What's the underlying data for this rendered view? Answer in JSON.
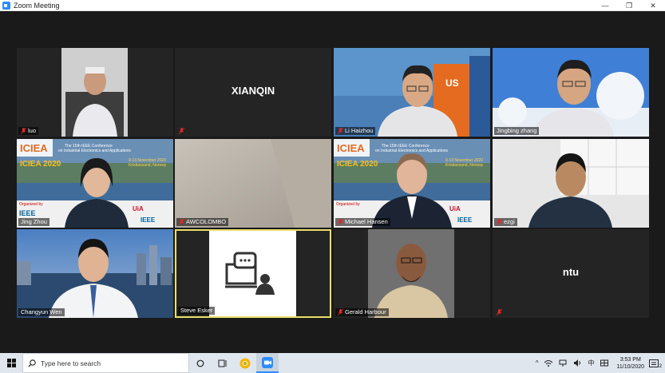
{
  "window": {
    "title": "Zoom Meeting",
    "minimize": "—",
    "maximize": "❐",
    "close": "✕"
  },
  "participants": [
    {
      "name": "luo",
      "muted": true,
      "video": true
    },
    {
      "name": "XIANQIN",
      "muted": true,
      "video": false,
      "display": "XIANQIN"
    },
    {
      "name": "Li Haizhou",
      "muted": true,
      "video": true
    },
    {
      "name": "Jingbing zhang",
      "muted": false,
      "video": true
    },
    {
      "name": "Jing Zhou",
      "muted": false,
      "video": true
    },
    {
      "name": "AWCOLOMBO",
      "muted": true,
      "video": true
    },
    {
      "name": "Michael Hansen",
      "muted": true,
      "video": true
    },
    {
      "name": "ezgi",
      "muted": true,
      "video": true
    },
    {
      "name": "Changyun Wen",
      "muted": false,
      "video": true
    },
    {
      "name": "Steve Esker",
      "muted": false,
      "video": true,
      "active": true
    },
    {
      "name": "Gerald Harbour",
      "muted": true,
      "video": true
    },
    {
      "name": "ntu",
      "muted": true,
      "video": false,
      "display": "ntu"
    }
  ],
  "banner": {
    "logo": "ICIEA",
    "year": "ICIEA 2020",
    "line1": "The 15th IEEE Conference",
    "line2": "on Industrial Electronics and Applications",
    "dates": "9-13 November 2020",
    "place": "Kristiansand, Norway",
    "organized": "Organized by",
    "ieee": "IEEE",
    "uia": "UiA"
  },
  "taskbar": {
    "search_placeholder": "Type here to search",
    "time": "3:53 PM",
    "date": "11/10/2020",
    "ime": "中",
    "notifications": "2"
  },
  "colors": {
    "active_speaker": "#e8e06a",
    "mute_red": "#e02828",
    "zoom_blue": "#2d8cff"
  }
}
